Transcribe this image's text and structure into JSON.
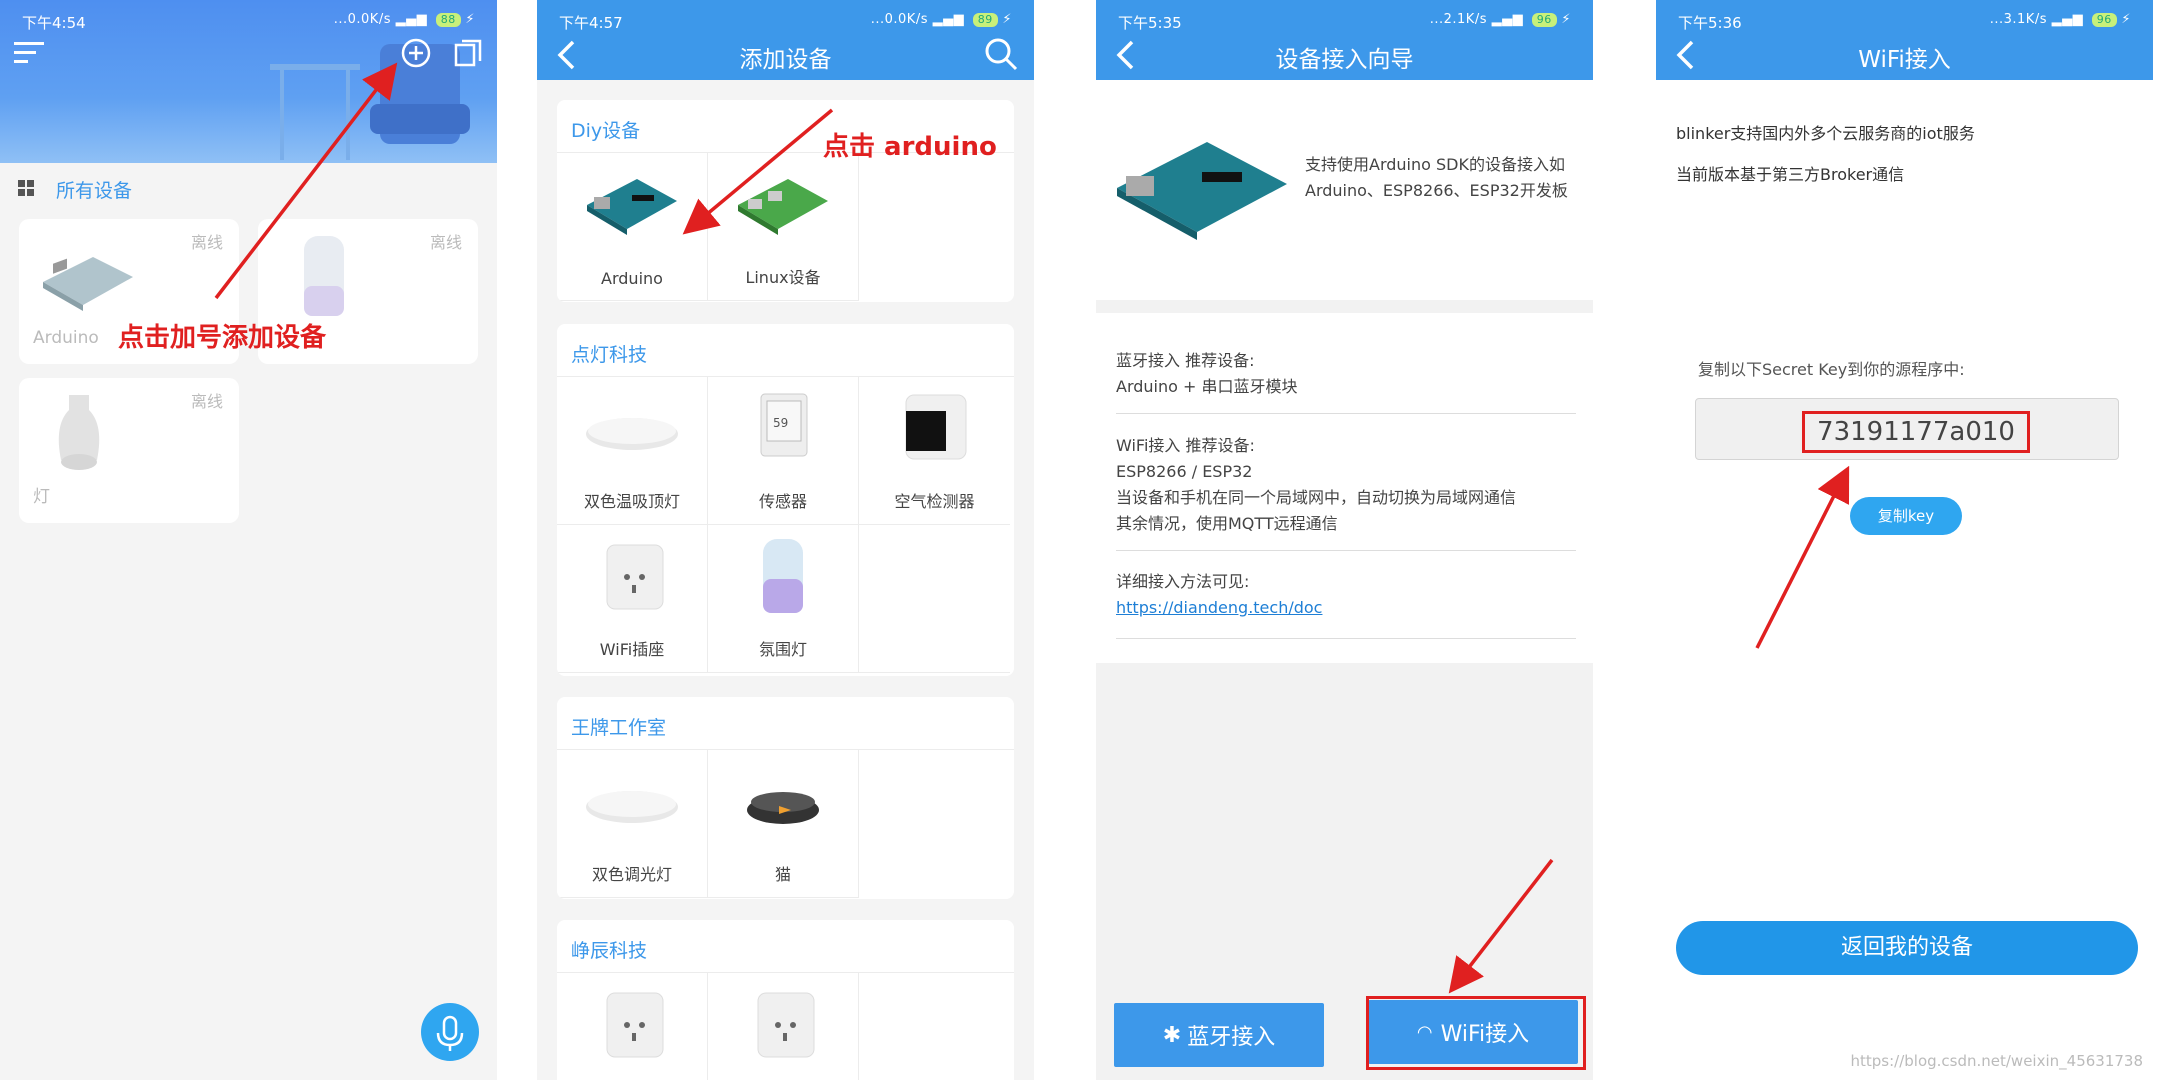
{
  "phone1": {
    "status": {
      "time": "下午4:54",
      "speed": "...0.0K/s",
      "battery": "88"
    },
    "section_title": "所有设备",
    "devices": [
      {
        "name": "Arduino",
        "status": "离线"
      },
      {
        "name": "",
        "status": "离线"
      },
      {
        "name": "灯",
        "status": "离线"
      }
    ],
    "annotation": "点击加号添加设备"
  },
  "phone2": {
    "status": {
      "time": "下午4:57",
      "speed": "...0.0K/s",
      "battery": "89"
    },
    "title": "添加设备",
    "annotation": "点击 arduino",
    "groups": [
      {
        "title": "Diy设备",
        "items": [
          "Arduino",
          "Linux设备"
        ]
      },
      {
        "title": "点灯科技",
        "items": [
          "双色温吸顶灯",
          "传感器",
          "空气检测器",
          "WiFi插座",
          "氛围灯"
        ]
      },
      {
        "title": "王牌工作室",
        "items": [
          "双色调光灯",
          "猫"
        ]
      },
      {
        "title": "峥辰科技",
        "items": [
          "",
          ""
        ]
      }
    ]
  },
  "phone3": {
    "status": {
      "time": "下午5:35",
      "speed": "...2.1K/s",
      "battery": "96"
    },
    "title": "设备接入向导",
    "description": "支持使用Arduino SDK的设备接入如Arduino、ESP8266、ESP32开发板",
    "bluetooth": {
      "heading": "蓝牙接入 推荐设备:",
      "line1": "Arduino + 串口蓝牙模块"
    },
    "wifi": {
      "heading": "WiFi接入 推荐设备:",
      "line1": "ESP8266 / ESP32",
      "line2": "当设备和手机在同一个局域网中，自动切换为局域网通信",
      "line3": "其余情况，使用MQTT远程通信"
    },
    "doc": {
      "heading": "详细接入方法可见:",
      "url": "https://diandeng.tech/doc"
    },
    "btn_bluetooth": "蓝牙接入",
    "btn_wifi": "WiFi接入"
  },
  "phone4": {
    "status": {
      "time": "下午5:36",
      "speed": "...3.1K/s",
      "battery": "96"
    },
    "title": "WiFi接入",
    "line1": "blinker支持国内外多个云服务商的iot服务",
    "line2": "当前版本基于第三方Broker通信",
    "key_label": "复制以下Secret Key到你的源程序中:",
    "secret_key": "73191177a010",
    "copy_key": "复制key",
    "back_button": "返回我的设备"
  },
  "watermark": "https://blog.csdn.net/weixin_45631738",
  "colors": {
    "primary": "#3d98ea",
    "annotation": "#e02020"
  }
}
